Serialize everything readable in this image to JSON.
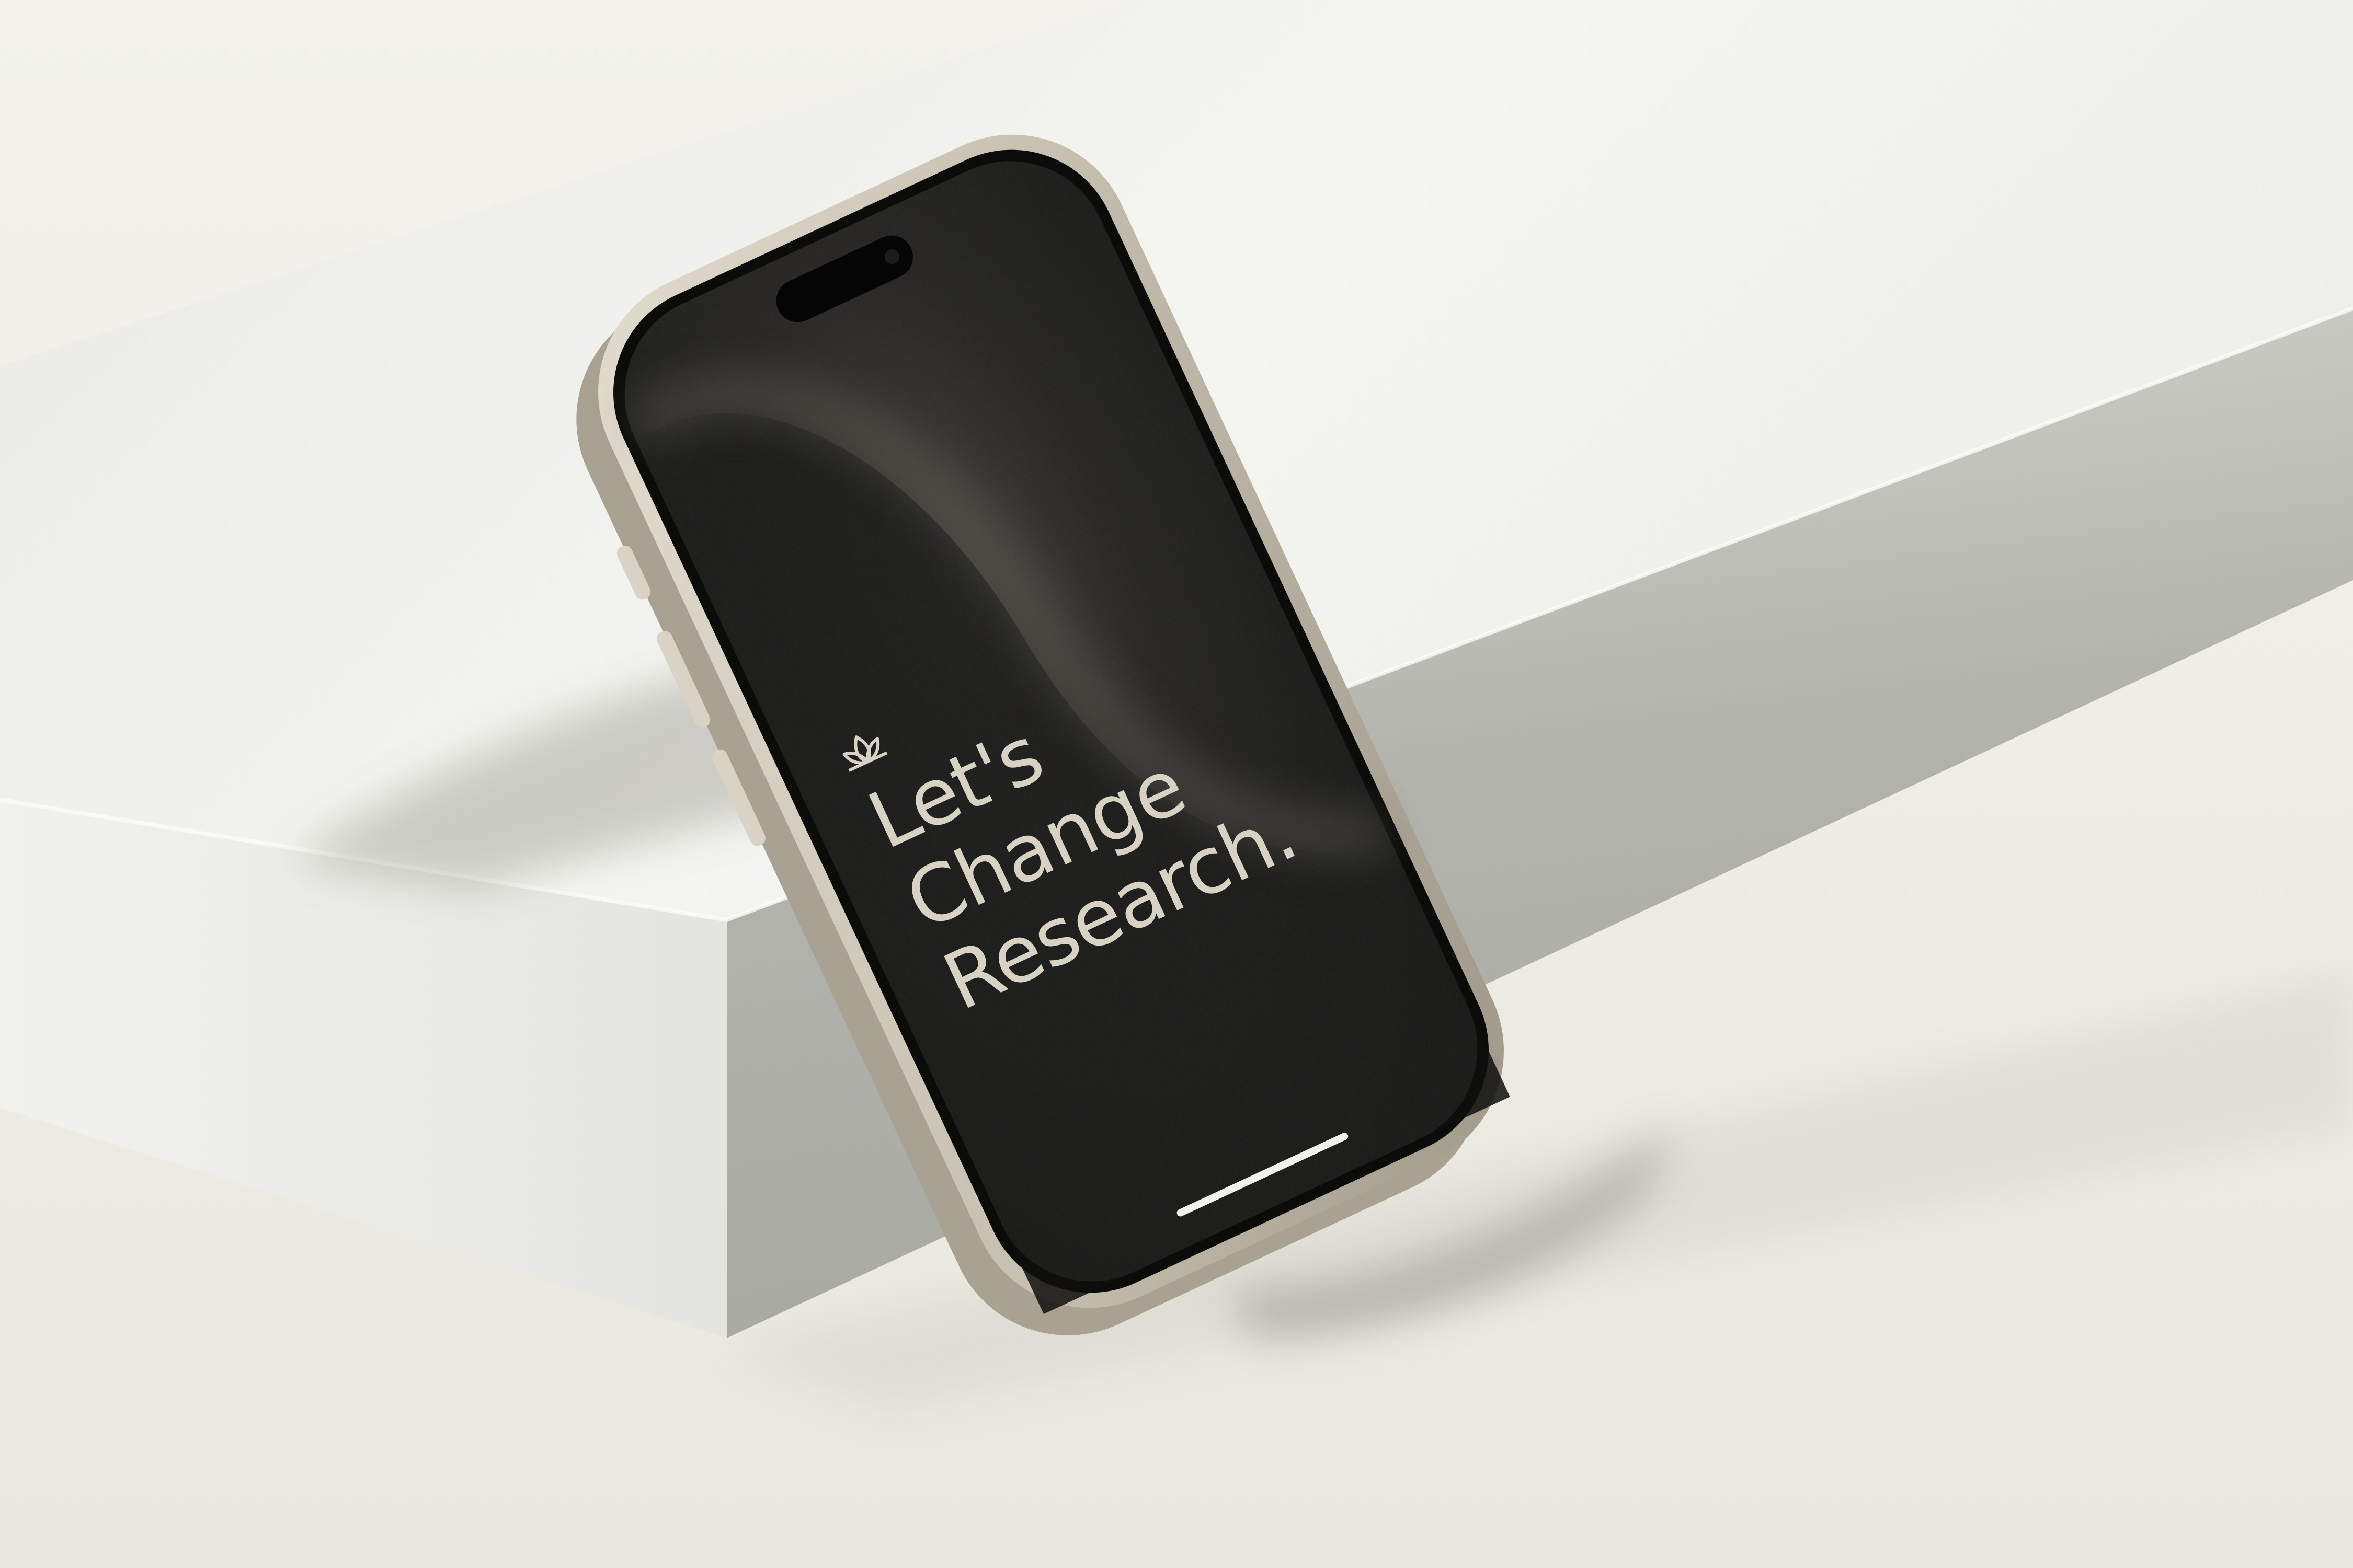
{
  "colors": {
    "background": "#ecebe3",
    "block_top": "#f0f0ec",
    "block_front": "#ebebe7",
    "block_side": "#b9b9b3",
    "phone_frame": "#cdc6b7",
    "screen": "#141413",
    "screen_text": "#d8d2c4",
    "home_indicator": "#f3f1ec"
  },
  "phone_screen": {
    "logo_icon": "lotus-icon",
    "headline": [
      "Let's",
      "Change",
      "Research."
    ]
  }
}
